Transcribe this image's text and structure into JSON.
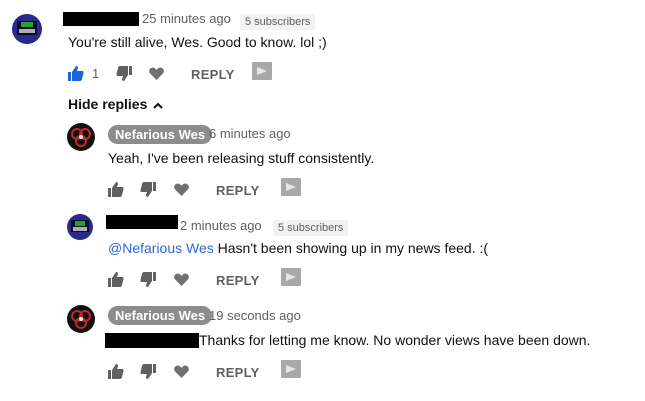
{
  "comments": [
    {
      "time": "25 minutes ago",
      "subs": "5 subscribers",
      "text": "You're still alive, Wes. Good to know. lol ;)",
      "likes": "1",
      "reply": "REPLY"
    }
  ],
  "hide_replies": "Hide replies",
  "replies": [
    {
      "author": "Nefarious Wes",
      "time": "6 minutes ago",
      "text": "Yeah, I've been releasing stuff consistently.",
      "reply": "REPLY"
    },
    {
      "time": "2 minutes ago",
      "subs": "5 subscribers",
      "mention": "@Nefarious Wes",
      "text": " Hasn't been showing up in my news feed. :(",
      "reply": "REPLY"
    },
    {
      "author": "Nefarious Wes",
      "time": "19 seconds ago",
      "text": "Thanks for letting me know. No wonder views have been down.",
      "reply": "REPLY"
    }
  ],
  "icons": [
    "thumb-up-icon",
    "thumb-down-icon",
    "heart-icon",
    "flag-icon",
    "chevron-up-icon"
  ]
}
